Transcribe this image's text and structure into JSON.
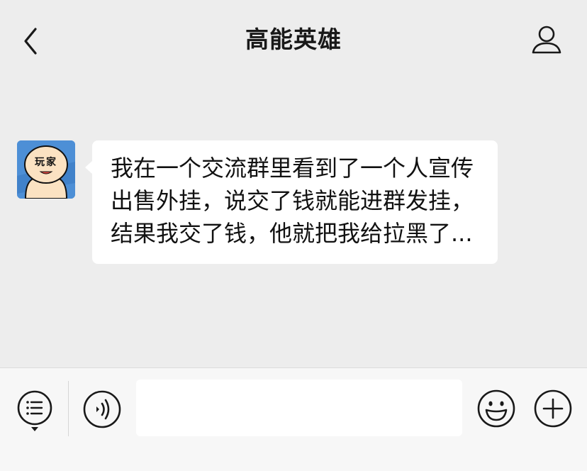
{
  "header": {
    "title": "高能英雄",
    "back_icon": "chevron-left-icon",
    "profile_icon": "person-icon"
  },
  "message": {
    "sender_avatar_text": "玩家",
    "text": "我在一个交流群里看到了一个人宣传出售外挂，说交了钱就能进群发挂，结果我交了钱，他就把我给拉黑了..."
  },
  "input_bar": {
    "menu_icon": "menu-list-icon",
    "voice_icon": "voice-icon",
    "input_value": "",
    "emoji_icon": "emoji-icon",
    "plus_icon": "plus-icon"
  },
  "colors": {
    "background": "#ededed",
    "bubble": "#ffffff",
    "avatar_bg": "#4d8fd6"
  }
}
